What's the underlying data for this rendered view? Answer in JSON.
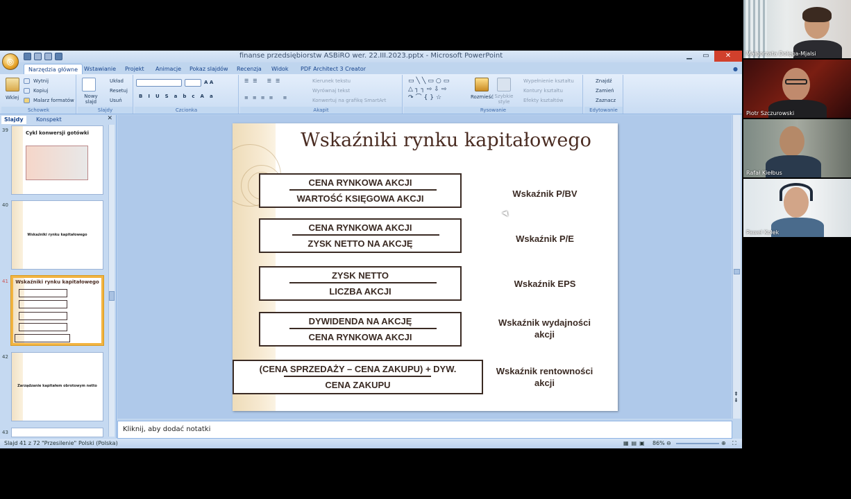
{
  "window": {
    "title": "finanse przedsiębiorstw ASBiRO wer. 22.III.2023.pptx - Microsoft PowerPoint"
  },
  "tabs": [
    "Narzędzia główne",
    "Wstawianie",
    "Projekt",
    "Animacje",
    "Pokaz slajdów",
    "Recenzja",
    "Widok",
    "PDF Architect 3 Creator"
  ],
  "ribbon": {
    "clipboard": {
      "label": "Schowek",
      "paste": "Wklej",
      "cut": "Wytnij",
      "copy": "Kopiuj",
      "painter": "Malarz formatów"
    },
    "slides": {
      "label": "Slajdy",
      "new_slide": "Nowy slajd",
      "layout": "Układ",
      "reset": "Resetuj",
      "delete": "Usuń"
    },
    "font": {
      "label": "Czcionka"
    },
    "paragraph": {
      "label": "Akapit",
      "text_dir": "Kierunek tekstu",
      "align_text": "Wyrównaj tekst",
      "smartart": "Konwertuj na grafikę SmartArt"
    },
    "drawing": {
      "label": "Rysowanie",
      "arrange": "Rozmieść",
      "quick_styles": "Szybkie style",
      "fill": "Wypełnienie kształtu",
      "outline": "Kontury kształtu",
      "effects": "Efekty kształtów"
    },
    "editing": {
      "label": "Edytowanie",
      "find": "Znajdź",
      "replace": "Zamień",
      "select": "Zaznacz"
    }
  },
  "panel": {
    "tabs": [
      "Slajdy",
      "Konspekt"
    ],
    "thumbs": [
      {
        "num": "39",
        "title": "Cykl konwersji gotówki"
      },
      {
        "num": "40",
        "title": "Wskaźniki rynku kapitałowego"
      },
      {
        "num": "41",
        "title": "Wskaźniki rynku kapitałowego"
      },
      {
        "num": "42",
        "title": "Zarządzanie kapitałem obrotowym netto"
      },
      {
        "num": "43",
        "title": ""
      }
    ]
  },
  "slide": {
    "title": "Wskaźniki rynku kapitałowego",
    "ratios": [
      {
        "num": "CENA RYNKOWA AKCJI",
        "den": "WARTOŚĆ KSIĘGOWA AKCJI",
        "label": "Wskaźnik P/BV"
      },
      {
        "num": "CENA RYNKOWA AKCJI",
        "den": "ZYSK NETTO NA AKCJĘ",
        "label": "Wskaźnik P/E"
      },
      {
        "num": "ZYSK NETTO",
        "den": "LICZBA AKCJI",
        "label": "Wskaźnik EPS"
      },
      {
        "num": "DYWIDENDA NA AKCJĘ",
        "den": "CENA RYNKOWA AKCJI",
        "label": "Wskaźnik wydajności akcji"
      },
      {
        "num": "(CENA SPRZEDAŻY – CENA ZAKUPU) + DYW.",
        "den": "CENA ZAKUPU",
        "label": "Wskaźnik rentowności akcji"
      }
    ]
  },
  "notes": {
    "placeholder": "Kliknij, aby dodać notatki"
  },
  "status": {
    "slide": "Slajd 41 z 72",
    "theme": "\"Przesilenie\"",
    "lang": "Polski (Polska)",
    "zoom": "86%"
  },
  "participants": [
    {
      "name": "Małgorzata Dołęga-Mjalsi"
    },
    {
      "name": "Piotr Szczurowski"
    },
    {
      "name": "Rafał Kiełbus"
    },
    {
      "name": "Paweł Kołek"
    }
  ],
  "colors": {
    "ribbon": "#dce8f7",
    "slide_text": "#3a2a23",
    "selected_thumb": "#f2b441"
  }
}
